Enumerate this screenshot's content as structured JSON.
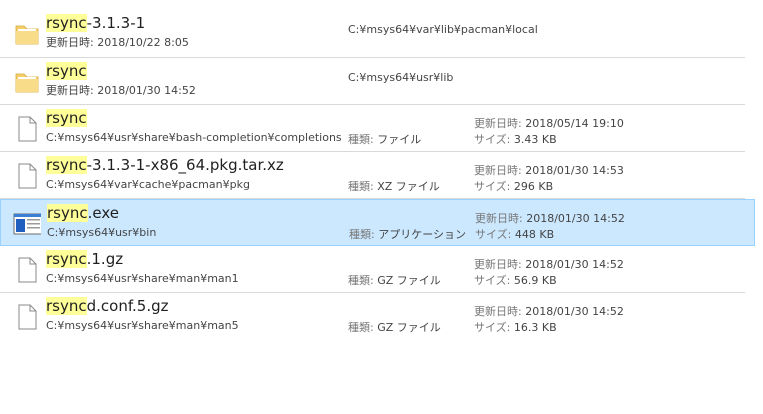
{
  "colors": {
    "highlight": "#ffff99",
    "selected_bg": "#cce8ff",
    "selected_border": "#99d1ff",
    "folder": "#f4cf6b"
  },
  "labels": {
    "modified": "更新日時:",
    "kind": "種類:",
    "size": "サイズ:"
  },
  "items": [
    {
      "icon": "folder-icon",
      "name_hl": "rsync",
      "name_rest": "-3.1.3-1",
      "date": "2018/10/22 8:05",
      "location": "C:¥msys64¥var¥lib¥pacman¥local"
    },
    {
      "icon": "folder-icon",
      "name_hl": "rsync",
      "name_rest": "",
      "date": "2018/01/30 14:52",
      "location": "C:¥msys64¥usr¥lib"
    },
    {
      "icon": "file-icon",
      "name_hl": "rsync",
      "name_rest": "",
      "path": "C:¥msys64¥usr¥share¥bash-completion¥completions",
      "kind": "ファイル",
      "date": "2018/05/14 19:10",
      "size": "3.43 KB"
    },
    {
      "icon": "file-icon",
      "name_hl": "rsync",
      "name_rest": "-3.1.3-1-x86_64.pkg.tar.xz",
      "path": "C:¥msys64¥var¥cache¥pacman¥pkg",
      "kind": "XZ ファイル",
      "date": "2018/01/30 14:53",
      "size": "296 KB"
    },
    {
      "icon": "application-icon",
      "name_hl": "rsync",
      "name_rest": ".exe",
      "path": "C:¥msys64¥usr¥bin",
      "kind": "アプリケーション",
      "date": "2018/01/30 14:52",
      "size": "448 KB",
      "selected": true
    },
    {
      "icon": "file-icon",
      "name_hl": "rsync",
      "name_rest": ".1.gz",
      "path": "C:¥msys64¥usr¥share¥man¥man1",
      "kind": "GZ ファイル",
      "date": "2018/01/30 14:52",
      "size": "56.9 KB"
    },
    {
      "icon": "file-icon",
      "name_hl": "rsync",
      "name_rest": "d.conf.5.gz",
      "path": "C:¥msys64¥usr¥share¥man¥man5",
      "kind": "GZ ファイル",
      "date": "2018/01/30 14:52",
      "size": "16.3 KB"
    }
  ]
}
